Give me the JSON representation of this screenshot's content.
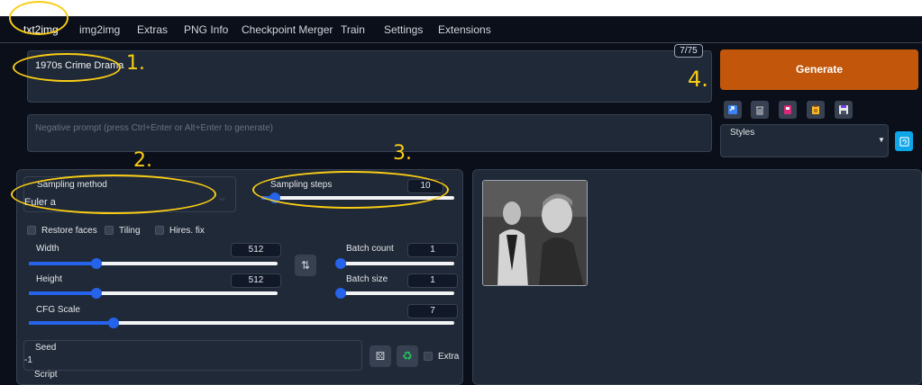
{
  "tabs": [
    "txt2img",
    "img2img",
    "Extras",
    "PNG Info",
    "Checkpoint Merger",
    "Train",
    "Settings",
    "Extensions"
  ],
  "prompt": {
    "value": "1970s Crime Drama",
    "token_counter": "7/75"
  },
  "negative_prompt": {
    "placeholder": "Negative prompt (press Ctrl+Enter or Alt+Enter to generate)"
  },
  "generate_label": "Generate",
  "styles_label": "Styles",
  "sampling": {
    "method_label": "Sampling method",
    "method_value": "Euler a",
    "steps_label": "Sampling steps",
    "steps_value": "10",
    "steps_fraction": 0.07
  },
  "options": {
    "restore_faces": "Restore faces",
    "tiling": "Tiling",
    "hires_fix": "Hires. fix"
  },
  "width": {
    "label": "Width",
    "value": "512",
    "fraction": 0.27
  },
  "height": {
    "label": "Height",
    "value": "512",
    "fraction": 0.27
  },
  "batch_count": {
    "label": "Batch count",
    "value": "1",
    "fraction": 0.0
  },
  "batch_size": {
    "label": "Batch size",
    "value": "1",
    "fraction": 0.0
  },
  "cfg": {
    "label": "CFG Scale",
    "value": "7",
    "fraction": 0.2
  },
  "seed": {
    "label": "Seed",
    "value": "-1",
    "extra_label": "Extra"
  },
  "script_label": "Script",
  "annotations": [
    "1.",
    "2.",
    "3.",
    "4."
  ],
  "colors": {
    "accent": "#2563eb",
    "generate": "#c2570c",
    "annotation": "#facc15"
  }
}
